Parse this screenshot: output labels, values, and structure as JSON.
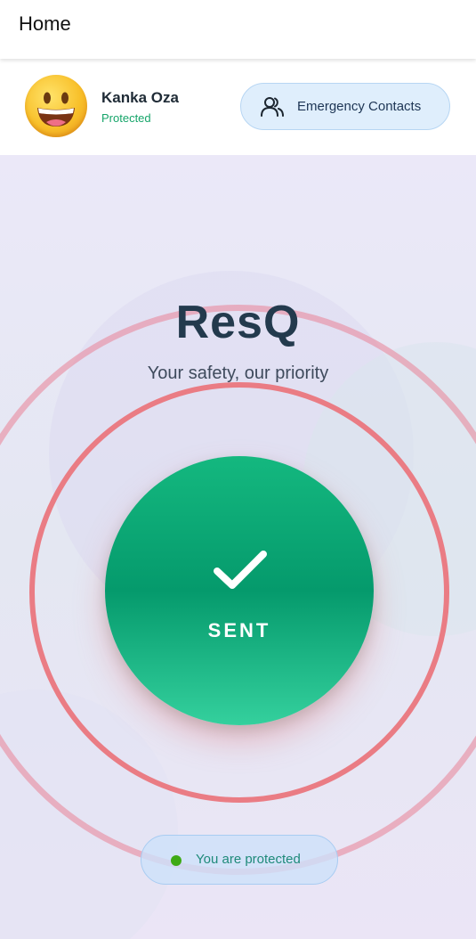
{
  "appbar": {
    "title": "Home"
  },
  "header": {
    "user_name": "Kanka Oza",
    "user_status": "Protected",
    "contacts_button_label": "Emergency Contacts",
    "avatar_icon": "grinning-face-emoji",
    "contacts_icon": "users-icon"
  },
  "hero": {
    "app_name": "ResQ",
    "tagline": "Your safety, our priority"
  },
  "sos_button": {
    "label": "SENT",
    "icon": "check-icon"
  },
  "status": {
    "text": "You are protected",
    "dot_color": "#3eaa15"
  },
  "colors": {
    "accent_green": "#059a6c",
    "ring_red": "#ea7c84",
    "title_dark": "#233a4d",
    "chip_blue": "#dfeefc"
  }
}
